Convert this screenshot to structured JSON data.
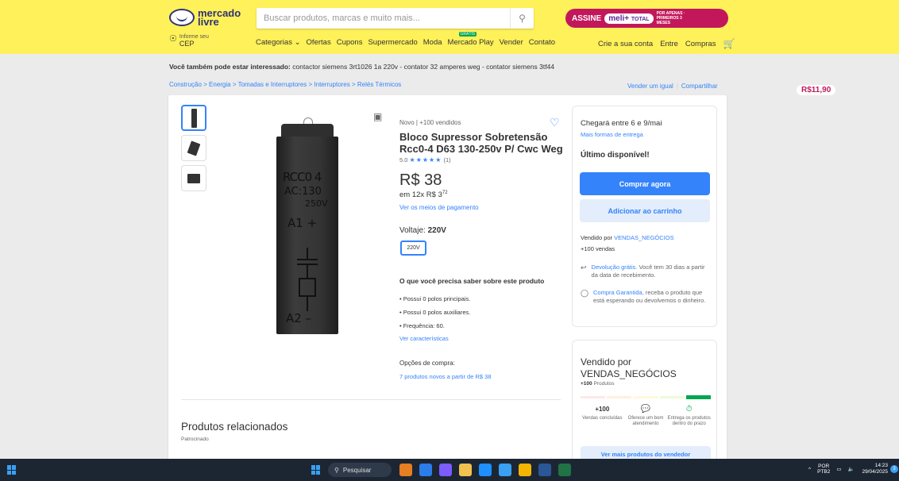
{
  "header": {
    "logo_text": "mercado livre",
    "search_placeholder": "Buscar produtos, marcas e muito mais...",
    "promo": {
      "assine": "ASSINE",
      "meli": "meli+",
      "total": "TOTAL",
      "price": "R$11,90",
      "label": "POR APENAS · PRIMEIROS 3 MESES"
    },
    "cep_small": "Informe seu",
    "cep_big": "CEP",
    "nav": [
      "Categorias ⌄",
      "Ofertas",
      "Cupons",
      "Supermercado",
      "Moda",
      "Mercado Play",
      "Vender",
      "Contato"
    ],
    "nav_badge": "GRÁTIS",
    "account": [
      "Crie a sua conta",
      "Entre",
      "Compras"
    ]
  },
  "interest": {
    "label": "Você também pode estar interessado:",
    "items": "contactor siemens 3rt1026 1a 220v - contator 32 amperes weg - contator siemens 3tf44"
  },
  "breadcrumb": "Construção  >  Energia  >  Tomadas e Interruptores  >  Interruptores  >  Relés Térmicos",
  "share": {
    "sell": "Vender um igual",
    "share": "Compartilhar"
  },
  "product": {
    "condition": "Novo  |  +100 vendidos",
    "title": "Bloco Supressor Sobretensão Rcc0-4 D63 130-250v P/ Cwc Weg",
    "rating": "5.0",
    "stars": "★★★★★",
    "reviews": "(1)",
    "price": "R$ 38",
    "installments": "em 12x R$ 3",
    "installments_cents": "72",
    "pay_link": "Ver os meios de pagamento",
    "voltage_label": "Voltaje:",
    "voltage_value": "220V",
    "voltage_option": "220V",
    "know_title": "O que você precisa saber sobre este produto",
    "features": [
      "Possui 0 polos principais.",
      "Possui 0 polos auxiliares.",
      "Frequência: 60."
    ],
    "features_link": "Ver características",
    "options_label": "Opções de compra:",
    "options_link": "7 produtos novos a partir de R$ 38",
    "related_title": "Produtos relacionados",
    "sponsored": "Patrocinado",
    "device_text": {
      "l1": "RCC0 4",
      "l2": "AC:130",
      "l3": "250V",
      "l4": "A1 +",
      "l5": "A2 –"
    }
  },
  "buybox": {
    "delivery": "Chegará entre 6 e 9/mai",
    "delivery_more": "Mais formas de entrega",
    "last": "Último disponível!",
    "buy_now": "Comprar agora",
    "add_cart": "Adicionar ao carrinho",
    "sold_by": "Vendido por",
    "seller": "VENDAS_NEGÓCIOS",
    "sales": "+100 vendas",
    "return_link": "Devolução grátis.",
    "return_text": "Você tem 30 dias a partir da data de recebimento.",
    "guarantee_link": "Compra Garantida,",
    "guarantee_text": "receba o produto que está esperando ou devolvemos o dinheiro."
  },
  "seller_card": {
    "title": "Vendido por VENDAS_NEGÓCIOS",
    "count_strong": "+100",
    "count_label": "Produtos",
    "level": 5,
    "level_colors": [
      "#fde8e8",
      "#fff0dd",
      "#fff9db",
      "#eefad9",
      "#00a650"
    ],
    "stats": [
      {
        "top": "+100",
        "label": "Vendas concluídas"
      },
      {
        "top": "💬",
        "label": "Oferece um bom atendimento"
      },
      {
        "top": "⏱",
        "label": "Entrega os produtos dentro do prazo"
      }
    ],
    "more_button": "Ver mais produtos do vendedor"
  },
  "taskbar": {
    "search": "Pesquisar",
    "lang_top": "POR",
    "lang_bottom": "PTB2",
    "time": "14:23",
    "date": "29/04/2025",
    "notification": "3",
    "app_colors": [
      "#e67e22",
      "#2b7de9",
      "#7a5cff",
      "#f2c14e",
      "#1e90ff",
      "#3aa0f3",
      "#f5b400",
      "#2b5797",
      "#217346"
    ]
  },
  "colors": {
    "accent": "#3483fa",
    "header": "#fff159",
    "success": "#00a650"
  }
}
